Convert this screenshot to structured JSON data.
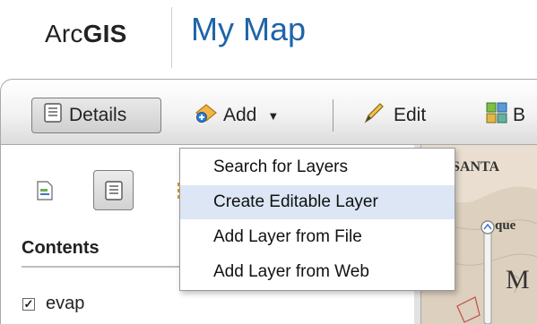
{
  "header": {
    "logo_plain": "Arc",
    "logo_bold": "GIS",
    "title": "My Map"
  },
  "toolbar": {
    "details_label": "Details",
    "add_label": "Add",
    "edit_label": "Edit",
    "basemap_label": "B"
  },
  "add_menu": {
    "items": [
      {
        "label": "Search for Layers"
      },
      {
        "label": "Create Editable Layer"
      },
      {
        "label": "Add Layer from File"
      },
      {
        "label": "Add Layer from Web"
      }
    ],
    "highlighted_index": 1
  },
  "left_panel": {
    "contents_label": "Contents",
    "layers": [
      {
        "label": "evap",
        "checked": true,
        "check_glyph": "✓"
      }
    ]
  },
  "map": {
    "label_top": "SANTA",
    "label_mid": "que",
    "label_mid2": "que",
    "label_big": "M"
  },
  "colors": {
    "title_blue": "#1e64a8",
    "menu_highlight": "#dce6f5",
    "map_bg": "#e9ded0"
  }
}
